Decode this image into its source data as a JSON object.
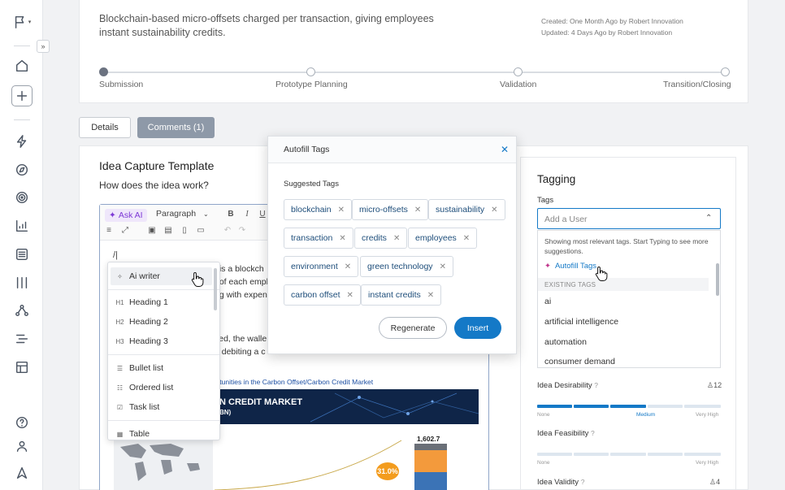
{
  "idea": {
    "description": "Blockchain-based micro-offsets charged per transaction, giving employees instant sustainability credits.",
    "created": "Created: One Month Ago by Robert Innovation",
    "updated": "Updated: 4 Days Ago by Robert Innovation"
  },
  "stages": [
    "Submission",
    "Prototype Planning",
    "Validation",
    "Transition/Closing"
  ],
  "tabs": [
    "Details",
    "Comments (1)"
  ],
  "template": {
    "title": "Idea Capture Template",
    "question": "How does the idea work?"
  },
  "editor": {
    "ask_ai": "Ask AI",
    "paragraph": "Paragraph",
    "slash": "/|",
    "text_lines": [
      "t is a blockch",
      "t of each empl",
      "ng with expens"
    ],
    "text_lines2": [
      "ved, the walle",
      "t, debiting a c"
    ]
  },
  "slash_menu": {
    "items": [
      {
        "icon": "✧",
        "label": "Ai writer"
      },
      {
        "icon": "H1",
        "label": "Heading 1"
      },
      {
        "icon": "H2",
        "label": "Heading 2"
      },
      {
        "icon": "H3",
        "label": "Heading 3"
      },
      {
        "icon": "☰",
        "label": "Bullet list"
      },
      {
        "icon": "☷",
        "label": "Ordered list"
      },
      {
        "icon": "☑",
        "label": "Task list"
      },
      {
        "icon": "▦",
        "label": "Table"
      }
    ]
  },
  "infographic": {
    "title": "portunities in the Carbon Offset/Carbon Credit Market",
    "banner": "N CREDIT MARKET",
    "banner_sub": "BN)",
    "value": "1,602.7",
    "cagr": "31.0%"
  },
  "modal": {
    "title": "Autofill Tags",
    "close": "✕",
    "suggested_label": "Suggested Tags",
    "tags": [
      "blockchain",
      "micro-offsets",
      "sustainability",
      "transaction",
      "credits",
      "employees",
      "environment",
      "green technology",
      "carbon offset",
      "instant credits"
    ],
    "regenerate": "Regenerate",
    "insert": "Insert"
  },
  "tagging": {
    "title": "Tagging",
    "tags_label": "Tags",
    "placeholder": "Add a User",
    "hint": "Showing most relevant tags. Start Typing to see more suggestions.",
    "autofill": "Autofill Tags",
    "existing_header": "EXISTING TAGS",
    "existing": [
      "ai",
      "artificial intelligence",
      "automation",
      "consumer demand"
    ]
  },
  "ratings": [
    {
      "label": "Idea Desirability",
      "q": "?",
      "count": "12",
      "level": "Medium",
      "low": "None",
      "high": "Very High"
    },
    {
      "label": "Idea Feasibility",
      "q": "?"
    },
    {
      "label": "Idea Validity",
      "q": "?",
      "count": "4"
    }
  ],
  "colors": {
    "accent": "#1479c7",
    "ai": "#7e3ad6",
    "bar_fill": "#1479c7",
    "bar_empty": "#dde6ef"
  }
}
